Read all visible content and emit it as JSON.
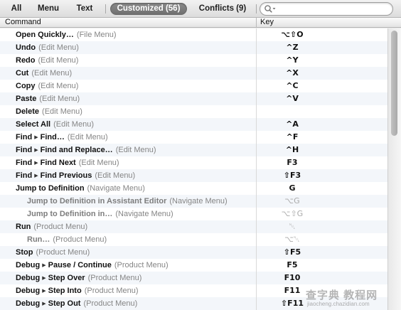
{
  "toolbar": {
    "filters": [
      {
        "label": "All"
      },
      {
        "label": "Menu"
      },
      {
        "label": "Text"
      },
      {
        "label": "Customized (56)",
        "active": true
      },
      {
        "label": "Conflicts (9)"
      }
    ],
    "search": {
      "placeholder": ""
    }
  },
  "columns": {
    "command": "Command",
    "key": "Key"
  },
  "rows": [
    {
      "command": "Open Quickly…",
      "path": [],
      "menu": "(File Menu)",
      "key": "⌥⇧O",
      "indent": false
    },
    {
      "command": "Undo",
      "path": [],
      "menu": "(Edit Menu)",
      "key": "^Z",
      "indent": false
    },
    {
      "command": "Redo",
      "path": [],
      "menu": "(Edit Menu)",
      "key": "^Y",
      "indent": false
    },
    {
      "command": "Cut",
      "path": [],
      "menu": "(Edit Menu)",
      "key": "^X",
      "indent": false
    },
    {
      "command": "Copy",
      "path": [],
      "menu": "(Edit Menu)",
      "key": "^C",
      "indent": false
    },
    {
      "command": "Paste",
      "path": [],
      "menu": "(Edit Menu)",
      "key": "^V",
      "indent": false
    },
    {
      "command": "Delete",
      "path": [],
      "menu": "(Edit Menu)",
      "key": "",
      "indent": false
    },
    {
      "command": "Select All",
      "path": [],
      "menu": "(Edit Menu)",
      "key": "^A",
      "indent": false
    },
    {
      "command": "Find",
      "path": [
        "Find…"
      ],
      "menu": "(Edit Menu)",
      "key": "^F",
      "indent": false
    },
    {
      "command": "Find",
      "path": [
        "Find and Replace…"
      ],
      "menu": "(Edit Menu)",
      "key": "^H",
      "indent": false
    },
    {
      "command": "Find",
      "path": [
        "Find Next"
      ],
      "menu": "(Edit Menu)",
      "key": "F3",
      "indent": false
    },
    {
      "command": "Find",
      "path": [
        "Find Previous"
      ],
      "menu": "(Edit Menu)",
      "key": "⇧F3",
      "indent": false
    },
    {
      "command": "Jump to Definition",
      "path": [],
      "menu": "(Navigate Menu)",
      "key": "G",
      "indent": false
    },
    {
      "command": "Jump to Definition in Assistant Editor",
      "path": [],
      "menu": "(Navigate Menu)",
      "key": "⌥G",
      "indent": true,
      "muted_key": true
    },
    {
      "command": "Jump to Definition in…",
      "path": [],
      "menu": "(Navigate Menu)",
      "key": "⌥⇧G",
      "indent": true,
      "muted_key": true
    },
    {
      "command": "Run",
      "path": [],
      "menu": "(Product Menu)",
      "key": "␀",
      "indent": false,
      "muted_key": true
    },
    {
      "command": "Run…",
      "path": [],
      "menu": "(Product Menu)",
      "key": "⌥␀",
      "indent": true,
      "muted_key": true
    },
    {
      "command": "Stop",
      "path": [],
      "menu": "(Product Menu)",
      "key": "⇧F5",
      "indent": false
    },
    {
      "command": "Debug",
      "path": [
        "Pause / Continue"
      ],
      "menu": "(Product Menu)",
      "key": "F5",
      "indent": false
    },
    {
      "command": "Debug",
      "path": [
        "Step Over"
      ],
      "menu": "(Product Menu)",
      "key": "F10",
      "indent": false
    },
    {
      "command": "Debug",
      "path": [
        "Step Into"
      ],
      "menu": "(Product Menu)",
      "key": "F11",
      "indent": false
    },
    {
      "command": "Debug",
      "path": [
        "Step Out"
      ],
      "menu": "(Product Menu)",
      "key": "⇧F11",
      "indent": false
    }
  ],
  "watermark": {
    "text": "查字典 教程网",
    "url": "jiaocheng.chazidian.com"
  }
}
